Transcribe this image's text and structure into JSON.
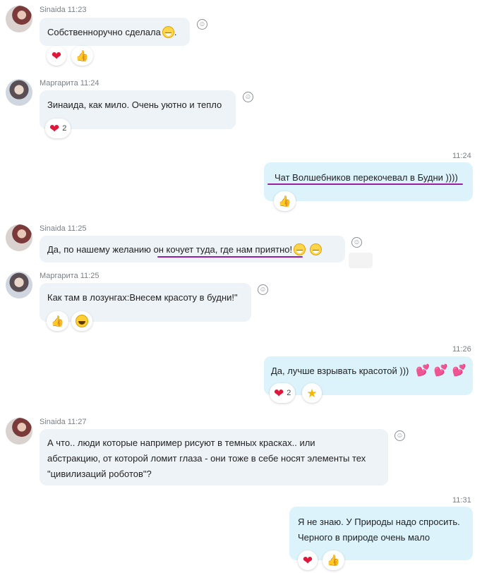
{
  "messages": [
    {
      "sender": "Sinaida",
      "time": "11:23",
      "text": "Собственноручно сделала",
      "suffix": ".",
      "reactions": [
        {
          "icon": "heart-icon"
        },
        {
          "icon": "thumbs-up-icon"
        }
      ]
    },
    {
      "sender": "Маргарита",
      "time": "11:24",
      "text": "Зинаида, как мило. Очень уютно и тепло",
      "reactions": [
        {
          "icon": "heart-icon",
          "count": "2"
        }
      ]
    },
    {
      "time": "11:24",
      "text": "Чат Волшебников перекочевал в Будни ))))",
      "reactions": [
        {
          "icon": "thumbs-up-icon"
        }
      ]
    },
    {
      "sender": "Sinaida",
      "time": "11:25",
      "text_before": "Да, по нашему желанию ",
      "text_underlined": "он кочует туда, где нам приятно!",
      "reactions": []
    },
    {
      "sender": "Маргарита",
      "time": "11:25",
      "text": "Как там в лозунгах:Внесем красоту в будни!\"",
      "reactions": [
        {
          "icon": "thumbs-up-icon"
        },
        {
          "icon": "laughing-emoji-icon"
        }
      ]
    },
    {
      "time": "11:26",
      "text": "Да, лучше взрывать красотой )))",
      "hearts": "💕💕💕",
      "reactions": [
        {
          "icon": "heart-icon",
          "count": "2"
        },
        {
          "icon": "star-icon"
        }
      ]
    },
    {
      "sender": "Sinaida",
      "time": "11:27",
      "lines": [
        "А что.. люди которые например рисуют в темных красках.. или",
        "абстракцию, от которой ломит глаза - они тоже в себе носят элементы тех",
        "\"цивилизаций роботов\"?"
      ],
      "reactions": []
    },
    {
      "time": "11:31",
      "lines": [
        "Я не знаю. У Природы надо спросить.",
        "Черного в природе очень мало"
      ],
      "reactions": [
        {
          "icon": "heart-icon"
        },
        {
          "icon": "thumbs-up-icon"
        }
      ]
    }
  ],
  "meta": {
    "m0": "Sinaida 11:23",
    "m1": "Маргарита 11:24",
    "m2": "11:24",
    "m3": "Sinaida 11:25",
    "m4": "Маргарита 11:25",
    "m5": "11:26",
    "m6": "Sinaida 11:27",
    "m7": "11:31"
  },
  "colors": {
    "incoming_bubble": "#eef3f8",
    "outgoing_bubble": "#dcf3fc",
    "underline": "#9b1fa6",
    "heart": "#e0173a",
    "hearts_emoji": "#e83fa8"
  }
}
